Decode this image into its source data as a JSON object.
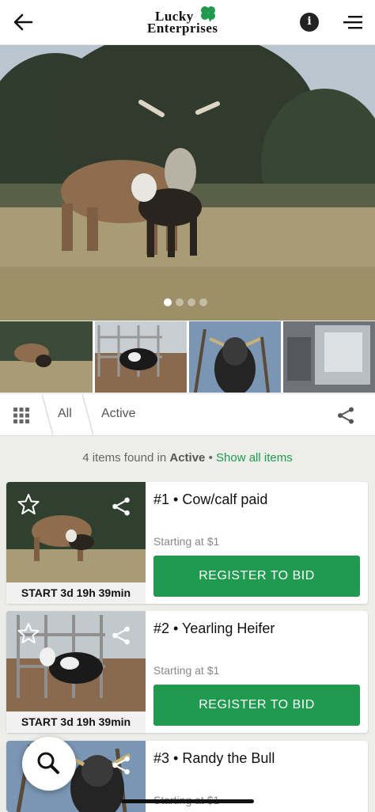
{
  "header": {
    "logo_line1": "Lucky",
    "logo_line2": "Enterprises",
    "user_initial": "i"
  },
  "filters": {
    "tab_all": "All",
    "tab_active": "Active"
  },
  "summary": {
    "prefix": "4 items found in",
    "filter": "Active",
    "separator": "•",
    "show_all": "Show all items"
  },
  "lots": [
    {
      "title": "#1 • Cow/calf paid",
      "start_text": "START 3d 19h 39min",
      "starting_at": "Starting at $1",
      "button": "REGISTER TO BID"
    },
    {
      "title": "#2 • Yearling Heifer",
      "start_text": "START 3d 19h 39min",
      "starting_at": "Starting at $1",
      "button": "REGISTER TO BID"
    },
    {
      "title": "#3 • Randy the Bull",
      "starting_at": "Starting at $1"
    }
  ],
  "icons": {
    "back": "arrow-left-icon",
    "menu": "menu-icon",
    "grid": "grid-icon",
    "share": "share-icon",
    "star": "star-icon",
    "search": "search-icon",
    "clover": "clover-icon"
  },
  "colors": {
    "accent": "#1f9a4f",
    "background": "#ededea"
  }
}
